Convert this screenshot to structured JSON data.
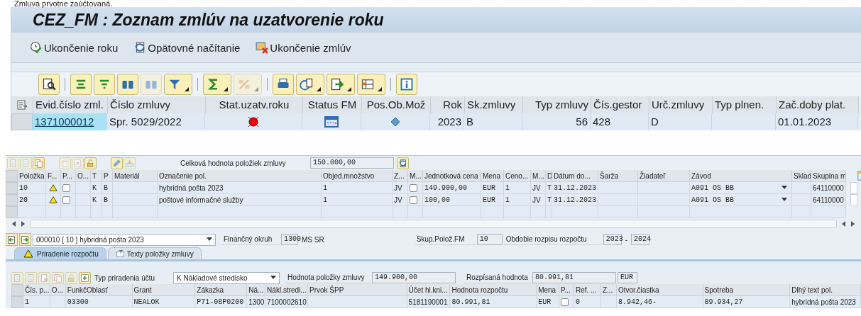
{
  "caption": "Zmluva prvotne zaúčtovaná.",
  "window": {
    "title": "CEZ_FM : Zoznam zmlúv na uzatvorenie roku"
  },
  "app_toolbar": [
    {
      "label": "Ukončenie roku"
    },
    {
      "label": "Opätovné načítanie"
    },
    {
      "label": "Ukončenie zmlúv"
    }
  ],
  "alv_toolbar": [
    [
      {
        "disabled": false,
        "menu": false
      }
    ],
    [
      {
        "disabled": false,
        "menu": false
      },
      {
        "disabled": false,
        "menu": false
      },
      {
        "disabled": false,
        "menu": false
      },
      {
        "disabled": true,
        "menu": false
      },
      {
        "disabled": false,
        "menu": true
      }
    ],
    [
      {
        "disabled": false,
        "menu": true
      },
      {
        "disabled": true,
        "menu": true
      }
    ],
    [
      {
        "disabled": false,
        "menu": false
      },
      {
        "disabled": false,
        "menu": true
      },
      {
        "disabled": false,
        "menu": true
      },
      {
        "disabled": false,
        "menu": true
      }
    ],
    [
      {
        "disabled": false,
        "menu": false
      }
    ]
  ],
  "contracts": {
    "columns": [
      {
        "label": "Evid.číslo zml.",
        "kind": "link"
      },
      {
        "label": "Číslo zmluvy",
        "kind": "text"
      },
      {
        "label": "Stat.uzatv.roku",
        "kind": "light"
      },
      {
        "label": "Status FM",
        "kind": "calendar"
      },
      {
        "label": "Pos.Ob.Mož",
        "kind": "diamond"
      },
      {
        "label": "Rok",
        "kind": "num"
      },
      {
        "label": "Sk.zmluvy",
        "kind": "text"
      },
      {
        "label": "Typ zmluvy",
        "kind": "num"
      },
      {
        "label": "Čís.gestor",
        "kind": "text"
      },
      {
        "label": "Urč.zmluvy",
        "kind": "text"
      },
      {
        "label": "Typ plnen.",
        "kind": "text"
      },
      {
        "label": "Zač.doby plat.",
        "kind": "text"
      }
    ],
    "rows": [
      [
        "1371000012",
        "Spr. 5029/2022",
        null,
        null,
        null,
        "2023",
        "B",
        "56",
        "428",
        "D",
        null,
        "01.01.2023"
      ]
    ]
  },
  "items_toolbar": {
    "buttons": [
      [
        {
          "disabled": true
        },
        {
          "disabled": true
        },
        {
          "disabled": false
        }
      ],
      [
        {
          "disabled": true
        },
        {
          "disabled": true
        },
        {
          "disabled": false
        }
      ],
      [
        {
          "disabled": false
        },
        {
          "disabled": true
        }
      ]
    ],
    "total_label": "Celková hodnota položiek zmluvy",
    "total_value": "150.000,00"
  },
  "items": {
    "columns": [
      {
        "label": "Položka",
        "kind": "mono"
      },
      {
        "label": "F...",
        "kind": "warn"
      },
      {
        "label": "P...",
        "kind": "check"
      },
      {
        "label": "O...",
        "kind": "text"
      },
      {
        "label": "T",
        "kind": "mono"
      },
      {
        "label": "P",
        "kind": "mono"
      },
      {
        "label": "Materiál",
        "kind": "text"
      },
      {
        "label": "Označenie pol.",
        "kind": "text"
      },
      {
        "label": "Objed.množstvo",
        "kind": "mono"
      },
      {
        "label": "Z...",
        "kind": "text"
      },
      {
        "label": "M...",
        "kind": "check"
      },
      {
        "label": "Jednotková cena",
        "kind": "mono"
      },
      {
        "label": "Mena",
        "kind": "mono"
      },
      {
        "label": "Ceno...",
        "kind": "mono"
      },
      {
        "label": "M...",
        "kind": "text"
      },
      {
        "label": "D",
        "kind": "mono"
      },
      {
        "label": "Dátum do...",
        "kind": "mono"
      },
      {
        "label": "Šarža",
        "kind": "text"
      },
      {
        "label": "Žiadateľ",
        "kind": "text"
      },
      {
        "label": "Závod",
        "kind": "select"
      },
      {
        "label": "Sklad",
        "kind": "text"
      },
      {
        "label": "Skupina m",
        "kind": "text"
      }
    ],
    "rows": [
      [
        "10",
        null,
        {
          "checked": false
        },
        null,
        "K",
        "B",
        null,
        "hybridná pošta 2023",
        "1",
        "JV",
        {
          "checked": false
        },
        "149.900,00",
        "EUR",
        "1",
        "JV",
        "T",
        "31.12.2023",
        null,
        null,
        "A091 OS BB",
        null,
        "64110000"
      ],
      [
        "20",
        null,
        {
          "checked": false
        },
        null,
        "K",
        "B",
        null,
        "poštové informačné služby",
        "1",
        "JV",
        {
          "checked": false
        },
        "100,00",
        "EUR",
        "1",
        "JV",
        "T",
        "31.12.2023",
        null,
        null,
        "A091 OS BB",
        null,
        "64110000"
      ]
    ]
  },
  "item_selector": {
    "value": "000010 [ 10 ] hybridná pošta 2023"
  },
  "fin_area": {
    "label": "Finančný okruh",
    "value": "1300",
    "text": "MS SR"
  },
  "item_group": {
    "label": "Skup.Polož.FM",
    "value": "10"
  },
  "period": {
    "label": "Obdobie rozpisu rozpočtu",
    "from": "2023",
    "separator": "-",
    "to": "2024"
  },
  "tabs": [
    {
      "label": "Priradenie rozpočtu",
      "selected": true
    },
    {
      "label": "Texty položky zmluvy",
      "selected": false
    }
  ],
  "assignment": {
    "buttons": [
      {
        "disabled": true
      },
      {
        "disabled": true
      },
      {
        "disabled": true
      },
      {
        "disabled": true
      },
      {
        "disabled": true
      },
      {
        "disabled": false
      }
    ],
    "type_label": "Typ priradenia účtu",
    "type_value": "K Nákladové stredisko",
    "value_label": "Hodnota položky zmluvy",
    "value": "149.900,00",
    "dist_label": "Rozpísaná hodnota",
    "dist_value": "80.991,81",
    "currency": "EUR"
  },
  "budget": {
    "columns": [
      {
        "label": "Čís. p...",
        "kind": "mono"
      },
      {
        "label": "O...",
        "kind": "text"
      },
      {
        "label": "FunkčOblasť",
        "kind": "mono"
      },
      {
        "label": "Grant",
        "kind": "mono"
      },
      {
        "label": "Zákazka",
        "kind": "mono"
      },
      {
        "label": "Ná...",
        "kind": "text"
      },
      {
        "label": "Nákl.stredi...",
        "kind": "text"
      },
      {
        "label": "Prvok ŠPP",
        "kind": "text"
      },
      {
        "label": "Účet hl.kni...",
        "kind": "text"
      },
      {
        "label": "Hodnota rozpočtu",
        "kind": "mono"
      },
      {
        "label": "Mena",
        "kind": "mono"
      },
      {
        "label": "P...",
        "kind": "check"
      },
      {
        "label": "Ref. ...",
        "kind": "mono"
      },
      {
        "label": "Z...",
        "kind": "text"
      },
      {
        "label": "Otvor.čiastka",
        "kind": "mono"
      },
      {
        "label": "Spotreba",
        "kind": "mono"
      },
      {
        "label": "Dlhý text pol.",
        "kind": "text"
      }
    ],
    "rows": [
      [
        "1",
        null,
        "03300",
        "NEALOK",
        "P71-08P0200",
        "1300",
        "7100002610",
        null,
        "5181190001",
        "80.991,81",
        "EUR",
        {
          "checked": false
        },
        "0",
        null,
        "8.942,46-",
        "89.934,27",
        "hybridná pošta 2023"
      ]
    ]
  }
}
